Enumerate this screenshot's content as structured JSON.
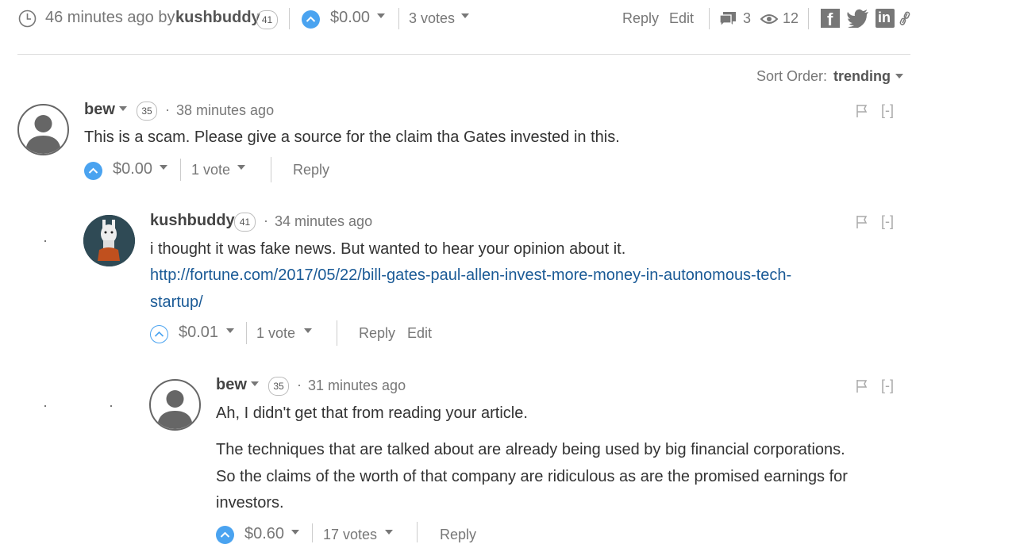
{
  "post_meta": {
    "time_author": "46 minutes ago by",
    "author": "kushbuddy",
    "author_rep": "41",
    "payout": "$0.00",
    "votes": "3 votes",
    "reply": "Reply",
    "edit": "Edit",
    "comments_count": "3",
    "views_count": "12"
  },
  "sort": {
    "label": "Sort Order:",
    "value": "trending"
  },
  "comments": [
    {
      "author": "bew",
      "rep": "35",
      "time": "38 minutes ago",
      "body": [
        "This is a scam. Please give a source for the claim tha Gates invested in this."
      ],
      "payout": "$0.00",
      "votes": "1 vote",
      "reply": "Reply",
      "collapse": "[-]"
    },
    {
      "author": "kushbuddy",
      "rep": "41",
      "time": "34 minutes ago",
      "body": [
        "i thought it was fake news. But wanted to hear your opinion about it."
      ],
      "link_line1": "http://fortune.com/2017/05/22/bill-gates-paul-allen-invest-more-money-in-autonomous-tech-",
      "link_line2": "startup/",
      "payout": "$0.01",
      "votes": "1 vote",
      "reply": "Reply",
      "edit": "Edit",
      "collapse": "[-]"
    },
    {
      "author": "bew",
      "rep": "35",
      "time": "31 minutes ago",
      "body": [
        "Ah, I didn't get that from reading your article.",
        "The techniques that are talked about are already being used by big financial corporations.",
        "So the claims of the worth of that company are ridiculous as are the promised earnings for",
        "investors."
      ],
      "payout": "$0.60",
      "votes": "17 votes",
      "reply": "Reply",
      "collapse": "[-]"
    }
  ],
  "colors": {
    "accent": "#4aa3f0",
    "link": "#1a5a96",
    "text": "#333333",
    "muted": "#777777"
  },
  "icons": [
    "clock-icon",
    "upvote-icon",
    "comments-icon",
    "eye-icon",
    "facebook-icon",
    "twitter-icon",
    "linkedin-icon",
    "link-icon",
    "flag-icon",
    "user-avatar-icon"
  ]
}
